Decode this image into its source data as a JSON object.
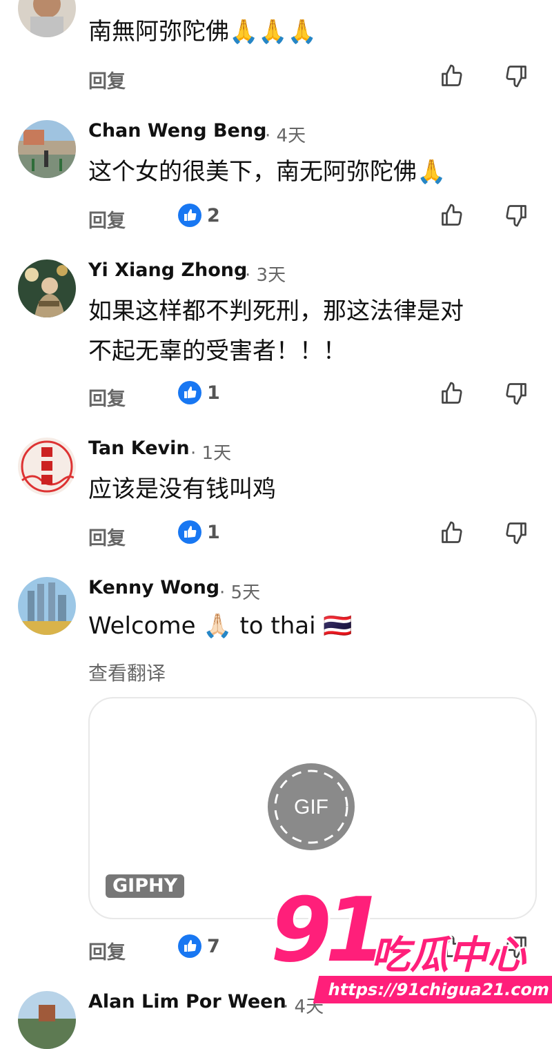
{
  "comments": [
    {
      "name": "",
      "time": "",
      "text_lines": [
        "南無阿弥陀佛🙏🙏🙏"
      ],
      "reply_label": "回复",
      "likes": ""
    },
    {
      "name": "Chan Weng Beng",
      "time": "· 4天",
      "text_lines": [
        "这个女的很美下，南无阿弥陀佛🙏"
      ],
      "reply_label": "回复",
      "likes": "2"
    },
    {
      "name": "Yi Xiang Zhong",
      "time": "· 3天",
      "text_lines": [
        "如果这样都不判死刑，那这法律是对",
        "不起无辜的受害者！！！"
      ],
      "reply_label": "回复",
      "likes": "1"
    },
    {
      "name": "Tan Kevin",
      "time": "· 1天",
      "text_lines": [
        "应该是没有钱叫鸡"
      ],
      "reply_label": "回复",
      "likes": "1"
    },
    {
      "name": "Kenny Wong",
      "time": "· 5天",
      "text_lines": [
        "Welcome 🙏🏻 to thai 🇹🇭"
      ],
      "translate_label": "查看翻译",
      "gif_label": "GIF",
      "giphy_label": "GIPHY",
      "reply_label": "回复",
      "likes": "7"
    },
    {
      "name": "Alan Lim Por Ween",
      "time": "· 4天"
    }
  ],
  "watermark": {
    "number": "91",
    "brand": "吃瓜中心",
    "url": "https://91chigua21.com"
  },
  "colors": {
    "like_badge": "#1877f2",
    "watermark": "#ff1f7a",
    "secondary_text": "#666666"
  }
}
